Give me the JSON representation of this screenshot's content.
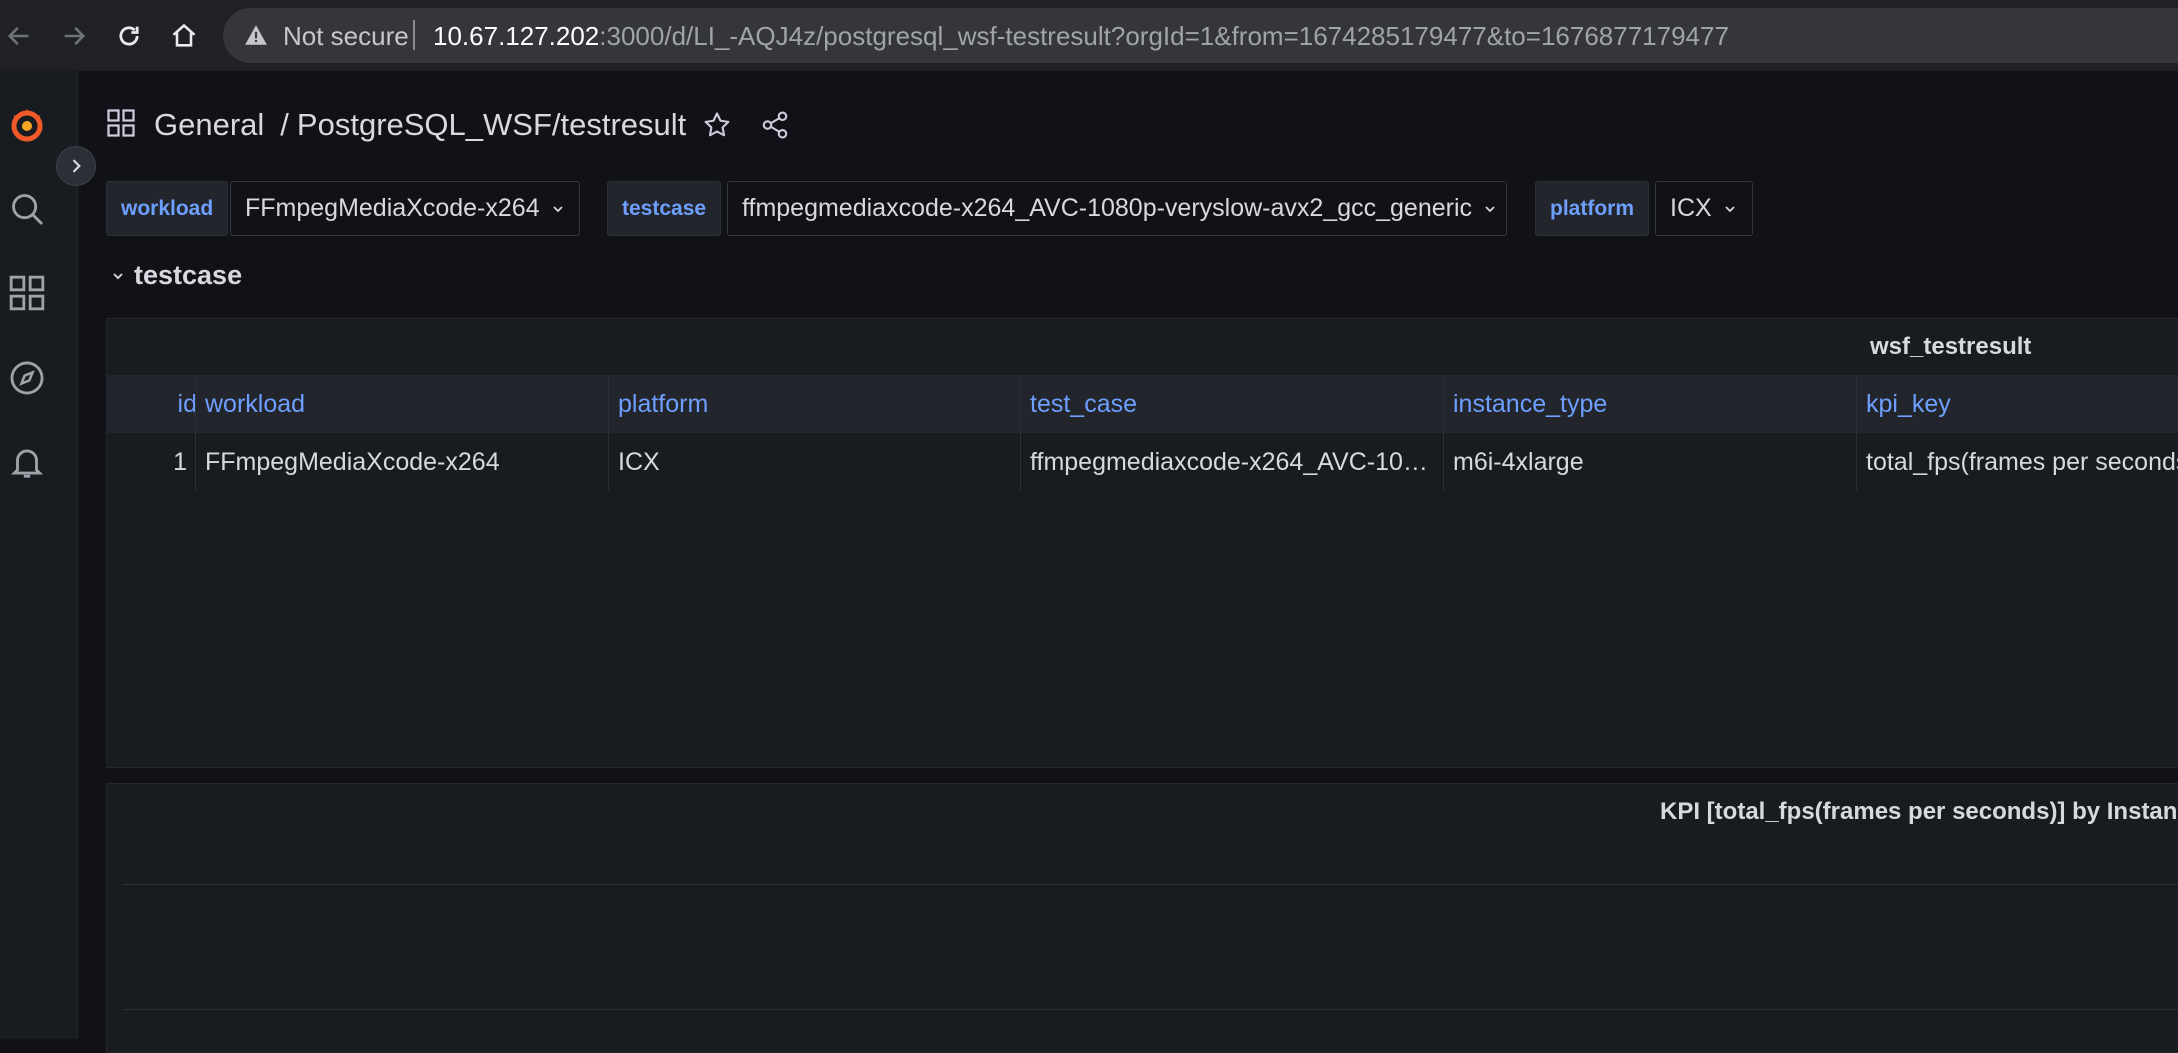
{
  "browser": {
    "security_label": "Not secure",
    "url_host": "10.67.127.202",
    "url_rest": ":3000/d/LI_-AQJ4z/postgresql_wsf-testresult?orgId=1&from=1674285179477&to=1676877179477"
  },
  "breadcrumb": {
    "folder": "General",
    "separator": "/",
    "title": "PostgreSQL_WSF/testresult"
  },
  "variables": [
    {
      "label": "workload",
      "value": "FFmpegMediaXcode-x264"
    },
    {
      "label": "testcase",
      "value": "ffmpegmediaxcode-x264_AVC-1080p-veryslow-avx2_gcc_generic"
    },
    {
      "label": "platform",
      "value": "ICX"
    }
  ],
  "row": {
    "title": "testcase"
  },
  "table": {
    "title": "wsf_testresult",
    "columns": [
      "id",
      "workload",
      "platform",
      "test_case",
      "instance_type",
      "kpi_key"
    ],
    "rows": [
      [
        "1",
        "FFmpegMediaXcode-x264",
        "ICX",
        "ffmpegmediaxcode-x264_AVC-10…",
        "m6i-4xlarge",
        "total_fps(frames per seconds)"
      ]
    ]
  },
  "chart": {
    "title": "KPI [total_fps(frames per seconds)] by Instance"
  },
  "colors": {
    "background": "#111217",
    "panel": "#181b1f",
    "accent_blue": "#6e9fff",
    "grafana_orange": "#f05a28"
  },
  "icons": {
    "nav": [
      "back-arrow-icon",
      "forward-arrow-icon",
      "reload-icon",
      "home-icon"
    ],
    "side": [
      "grafana-logo-icon",
      "search-icon",
      "dashboards-icon",
      "explore-icon",
      "alerting-bell-icon"
    ]
  }
}
